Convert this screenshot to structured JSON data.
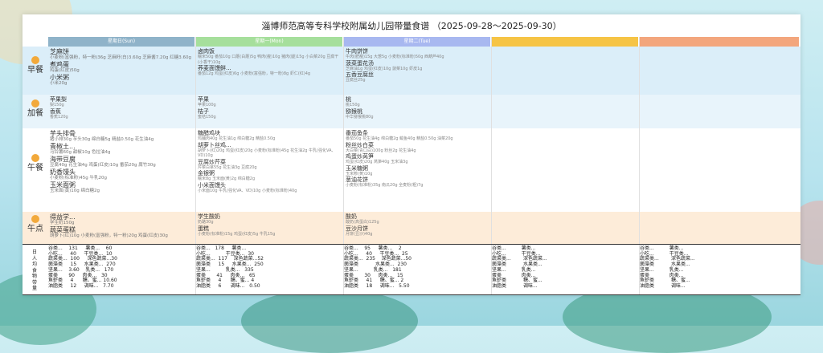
{
  "title": "淄博师范高等专科学校附属幼儿园带量食谱 （2025-09-28～2025-09-30）",
  "days": [
    {
      "label": "星期日(Sun)",
      "color": "#8fb3c9"
    },
    {
      "label": "星期一(Mon)",
      "color": "#a6df9c"
    },
    {
      "label": "星期二(Tue)",
      "color": "#a8b8f0"
    },
    {
      "label": "",
      "color": "#f6c445"
    },
    {
      "label": "",
      "color": "#f3a67d"
    }
  ],
  "meals": [
    {
      "key": "breakfast",
      "label": "早餐",
      "bg": "#dbeef9"
    },
    {
      "key": "snack1",
      "label": "加餐",
      "bg": "#e8f4fb"
    },
    {
      "key": "lunch",
      "label": "午餐",
      "bg": "#ffffff"
    },
    {
      "key": "snack2",
      "label": "午点",
      "bg": "#fdecd9"
    }
  ],
  "menu": {
    "breakfast": [
      [
        {
          "dish": "芝麻饼",
          "ing": "小麦粉(富强粉，特一粉)36g 芝麻籽(白)3.60g 芝麻酱7.20g 红糖3.60g"
        },
        {
          "dish": "煮鸡蛋",
          "ing": "鸡蛋(红皮)50g"
        },
        {
          "dish": "小米粥",
          "ing": "小米20g"
        }
      ],
      [
        {
          "dish": "卤肉饭",
          "ing": "糯米50g 番茄10g 口蘑(白蘑)5g 鸭肉(瘦)10g 猪肉(腿)15g 小白菜20g 豆腐干(小香干)10g"
        },
        {
          "dish": "荞麦面馒鲜...",
          "ing": "番茄12g 鸡蛋(红皮)6g 小麦粉(富强粉，特一粉)8g 虾仁(红)4g"
        }
      ],
      [
        {
          "dish": "牛肉饼饼",
          "ing": "牛肉(肥瘦)15g 大葱5g 小麦粉(标准粉)50g 西葫芦40g"
        },
        {
          "dish": "菠菜蛋花汤",
          "ing": "芝麻油1g 鸡蛋(红皮)10g 菠菜10g 虾皮1g"
        },
        {
          "dish": "五香豆腐丝",
          "ing": "豆腐丝25g"
        }
      ],
      [],
      []
    ],
    "snack1": [
      [
        {
          "dish": "苹果梨",
          "ing": "梨150g"
        },
        {
          "dish": "香蕉",
          "ing": "香蕉120g"
        }
      ],
      [
        {
          "dish": "苹果",
          "ing": "苹果100g"
        },
        {
          "dish": "桔子",
          "ing": "蜜桔150g"
        }
      ],
      [
        {
          "dish": "桃",
          "ing": "桃150g"
        },
        {
          "dish": "猕猴桃",
          "ing": "中华猕猴桃80g"
        }
      ],
      [],
      []
    ],
    "lunch": [
      [
        {
          "dish": "芋头排骨",
          "ing": "猪小排30g 芋头30g 绵白糖5g 精盐0.50g 花生油4g"
        },
        {
          "dish": "青椒土...",
          "ing": "马铃薯60g 甜椒10g 色拉油4g"
        },
        {
          "dish": "海带豆腐",
          "ing": "豆腐40g 花生油4g 鸡蛋(红皮)10g 番茄20g 腐竹30g"
        },
        {
          "dish": "奶香馒头",
          "ing": "小麦粉(标准粉)45g 牛乳20g"
        },
        {
          "dish": "玉米面粥",
          "ing": "玉米面(黄)10g 绵白糖2g"
        }
      ],
      [
        {
          "dish": "糖醋鸡块",
          "ing": "鸡脯肉40g 花生油1g 绵白糖2g 精盐0.50g"
        },
        {
          "dish": "胡萝卜丝鸡...",
          "ing": "胡萝卜(红)20g 鸡蛋(红皮)20g 小麦粉(标准粉)45g 花生油2g 牛乳(强化VA、VD)10g"
        },
        {
          "dish": "豆腐炒芹菜",
          "ing": "芹菜白茎55g 花生油3g 豆腐20g"
        },
        {
          "dish": "金银粥",
          "ing": "糯米8g 玉米面(黄)2g 绵白糖2g"
        },
        {
          "dish": "小米面馒头",
          "ing": "小米面10g 牛乳(强化VA、VD)10g 小麦粉(标准粉)40g"
        }
      ],
      [
        {
          "dish": "番茄鱼条",
          "ing": "番茄50g 花生油4g 绵白糖2g 鲅鱼40g 精盐0.50g 油菜20g"
        },
        {
          "dish": "粉丝炒白菜",
          "ing": "大白菜(青口白)100g 粉丝2g 花生油4g"
        },
        {
          "dish": "鸡蛋炒莴笋",
          "ing": "鸡蛋(红皮)20g 莴笋40g 玉米油3g"
        },
        {
          "dish": "玉米糖粥",
          "ing": "玉米糁(黄)10g"
        },
        {
          "dish": "葱油花饼",
          "ing": "小麦粉(标准粉)35g 南瓜20g 全麦粉(粗)7g"
        }
      ],
      [],
      []
    ],
    "snack2": [
      [
        {
          "dish": "得益学...",
          "ing": "学生奶150g"
        },
        {
          "dish": "蔬菜蛋糕",
          "ing": "胡萝卜(红)10g 小麦粉(富强粉，特一粉)20g 鸡蛋(红皮)30g"
        }
      ],
      [
        {
          "dish": "学生酸奶",
          "ing": "奶酪30g"
        },
        {
          "dish": "蛋糕",
          "ing": "小麦粉(标准粉)15g 鸡蛋(红皮)5g 牛乳15g"
        }
      ],
      [
        {
          "dish": "酸奶",
          "ing": "酸奶(高蛋白)125g"
        },
        {
          "dish": "豆沙月饼",
          "ing": "月饼(豆沙)40g"
        }
      ],
      [],
      []
    ]
  },
  "stats_label": "日人均食物带量",
  "stats": [
    "谷类...    131     薯类...    60\n小吃...     40     干豆类...  10\n蔬菜类...  100     深色蔬菜...30\n菌藻类     15     水果类...  270\n坚果...    3.60    乳类...   170\n蛋类       90     肉类...   30\n鱼虾类     4      糖、蜜... 10.60\n油脂类     12     调味...   7.70",
    "谷类...   178     薯类...\n小吃...          干豆类...  30\n蔬菜类...  117    深色蔬菜...52\n菌藻类     15     水果类...  250\n坚果...          乳类...   335\n蛋类       41     肉类...   65\n鱼虾类     4      糖、蜜... 4\n油脂类     6      调味...   0.50",
    "谷类...    95     薯类...    2\n小吃...     40     干豆类...  25\n蔬菜类...  235    深色蔬菜...50\n菌藻类           水果类...  230\n坚果...          乳类...   181\n蛋类       30     肉类...   15\n鱼虾类     41     糖、蜜... 2\n油脂类     18     调味...   5.50",
    "谷类...          薯类...\n小吃...          干豆类...\n蔬菜类...        深色蔬菜...\n菌藻类           水果类...\n坚果...          乳类...\n蛋类             肉类...\n鱼虾类           糖、蜜...\n油脂类           调味...",
    "谷类...          薯类...\n小吃...          干豆类...\n蔬菜类...        深色蔬菜...\n菌藻类           水果类...\n坚果...          乳类...\n蛋类             肉类...\n鱼虾类           糖、蜜...\n油脂类           调味..."
  ]
}
